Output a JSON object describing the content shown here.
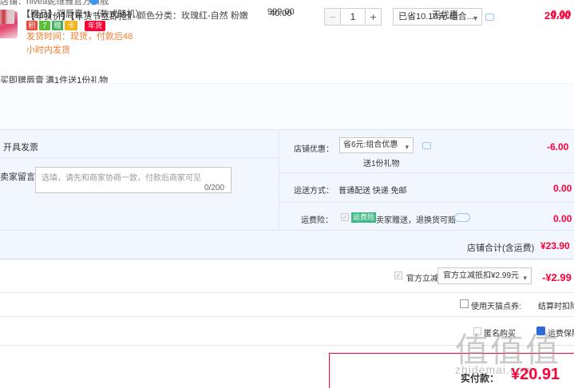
{
  "shop": {
    "label": "店铺：nivea妮维雅官方旗舰"
  },
  "item": {
    "title": "【年货价】【年货节立即抢购】...",
    "tags": [
      "积",
      "7",
      "赠",
      "卡"
    ],
    "nianhuo_badge": "年货",
    "ship_note": "发货时间：现货，付款后48小时内发货",
    "sku": "颜色分类：玫瑰红-自然 粉嫩",
    "price": "40.00",
    "quantity": "1",
    "minus": "−",
    "plus": "+",
    "promo_select": "已省10.10元:组合...",
    "total": "29.90"
  },
  "gift": {
    "header_prefix": "买即赠唇膏",
    "header_rule": "满1件送1份礼物",
    "title": "【赠品】润唇膏*1（款式随机）",
    "price": "999.00",
    "promo": "无优惠",
    "total": "0.00"
  },
  "options": {
    "invoice": "开具发票",
    "message_label": "卖家留言：",
    "message_placeholder": "选填，请先和商家协商一致，付款后商家可见",
    "message_count": "0/200",
    "shop_discount_label": "店铺优惠：",
    "shop_discount_select": "省6元:组合优惠",
    "gift_note": "送1份礼物",
    "shop_discount_value": "-6.00",
    "shipping_label": "运送方式：",
    "shipping_value": "普通配送 快递 免邮",
    "shipping_amount": "0.00",
    "insurance_label": "运费险：",
    "insurance_badge": "运费险",
    "insurance_text": "卖家赠送，退换货可赔",
    "insurance_amount": "0.00",
    "shop_total_label": "店铺合计(含运费)",
    "shop_total_value": "¥23.90"
  },
  "bottom": {
    "official_cut_label": "官方立减",
    "official_cut_select": "官方立减抵扣¥2.99元",
    "official_cut_value": "-¥2.99",
    "points_label": "使用天猫点券:",
    "points_note": "结算时扣除",
    "anon_label": "匿名购买",
    "right_text": "运费保险",
    "pay_label": "实付款：",
    "pay_value": "¥20.91"
  },
  "watermark": {
    "glyphs": "值值值",
    "url": "zhidemai.com"
  },
  "colors": {
    "accent": "#ff0036",
    "panel_bg": "#f2f7ff",
    "ship_note": "#f57a2c"
  }
}
